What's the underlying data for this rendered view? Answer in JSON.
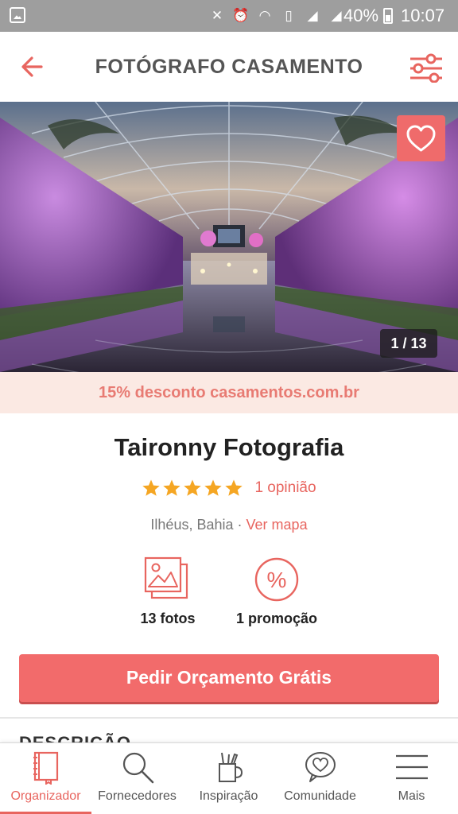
{
  "status_bar": {
    "battery": "40%",
    "time": "10:07",
    "icons": [
      "gallery-icon",
      "mute-icon",
      "alarm-icon",
      "wifi-icon",
      "vibrate-icon",
      "signal-icon",
      "signal-full-icon",
      "battery-icon"
    ]
  },
  "header": {
    "title": "FOTÓGRAFO CASAMENTO",
    "back_icon": "back-arrow-icon",
    "filter_icon": "filter-sliders-icon"
  },
  "hero": {
    "counter": "1 / 13",
    "favorite_icon": "heart-icon"
  },
  "promo_banner": "15% desconto casamentos.com.br",
  "vendor": {
    "name": "Taironny Fotografia",
    "stars": 5,
    "reviews": "1 opinião",
    "city": "Ilhéus, Bahia",
    "separator": "·",
    "map_link": "Ver mapa"
  },
  "stats": {
    "photos": "13 fotos",
    "promotions": "1 promoção"
  },
  "cta": "Pedir Orçamento Grátis",
  "section_peek": "DESCRIÇÃO",
  "bottom_nav": [
    {
      "label": "Organizador",
      "icon": "notebook-icon",
      "active": true
    },
    {
      "label": "Fornecedores",
      "icon": "search-icon",
      "active": false
    },
    {
      "label": "Inspiração",
      "icon": "pencil-cup-icon",
      "active": false
    },
    {
      "label": "Comunidade",
      "icon": "chat-heart-icon",
      "active": false
    },
    {
      "label": "Mais",
      "icon": "menu-icon",
      "active": false
    }
  ],
  "colors": {
    "accent": "#e8655f",
    "cta": "#f26b6b",
    "promo_bg": "#fbe9e3",
    "star": "#f5a623"
  }
}
